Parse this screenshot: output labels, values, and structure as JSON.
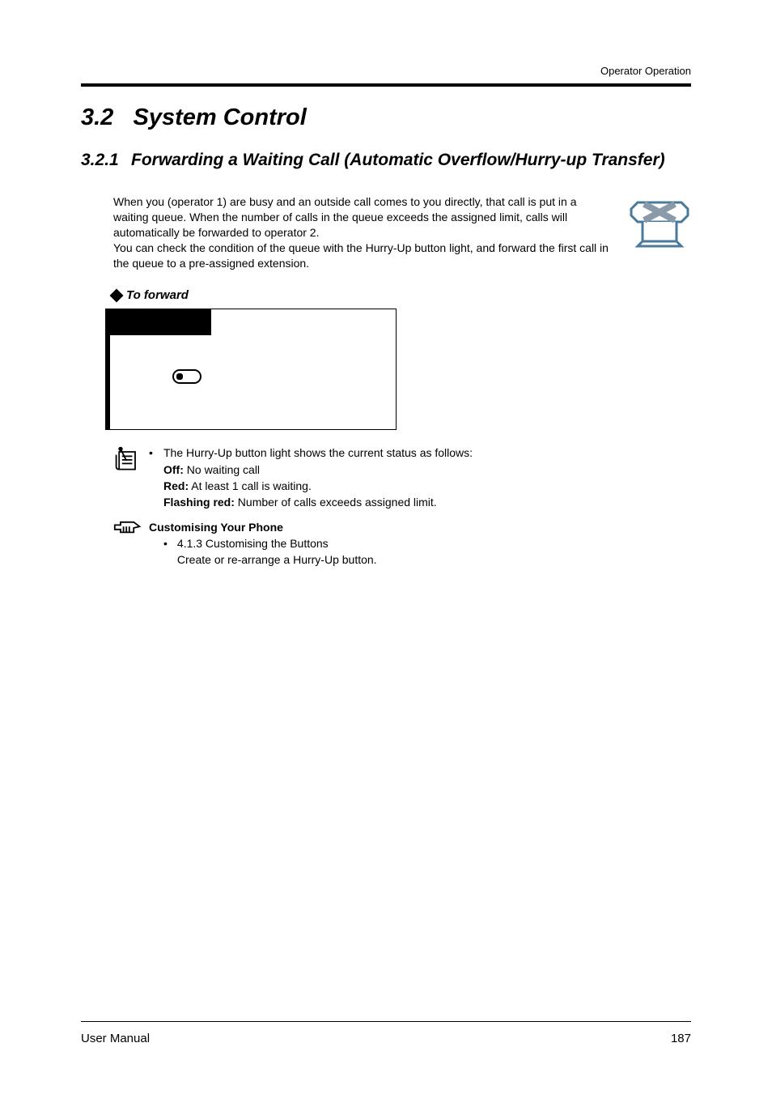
{
  "header": {
    "category": "Operator Operation"
  },
  "section": {
    "number": "3.2",
    "title": "System Control"
  },
  "subsection": {
    "number": "3.2.1",
    "title": "Forwarding a Waiting Call (Automatic Overflow/Hurry-up Transfer)"
  },
  "intro": "When you (operator 1) are busy and an outside call comes to you directly, that call is put in a waiting queue. When the number of calls in the queue exceeds the assigned limit, calls will automatically be forwarded to operator 2.\nYou can check the condition of the queue with the Hurry-Up button light, and forward the first call in the queue to a pre-assigned extension.",
  "procedure": {
    "heading": "To forward"
  },
  "notes": {
    "lead": "The Hurry-Up button light shows the current status as follows:",
    "states": {
      "off_label": "Off:",
      "off_text": " No waiting call",
      "red_label": "Red:",
      "red_text": " At least 1 call is waiting.",
      "flashing_label": "Flashing red:",
      "flashing_text": " Number of calls exceeds assigned limit."
    }
  },
  "customising": {
    "title": "Customising Your Phone",
    "item_ref": "4.1.3   Customising the Buttons",
    "item_desc": "Create or re-arrange a Hurry-Up button."
  },
  "footer": {
    "doc": "User Manual",
    "page": "187"
  }
}
